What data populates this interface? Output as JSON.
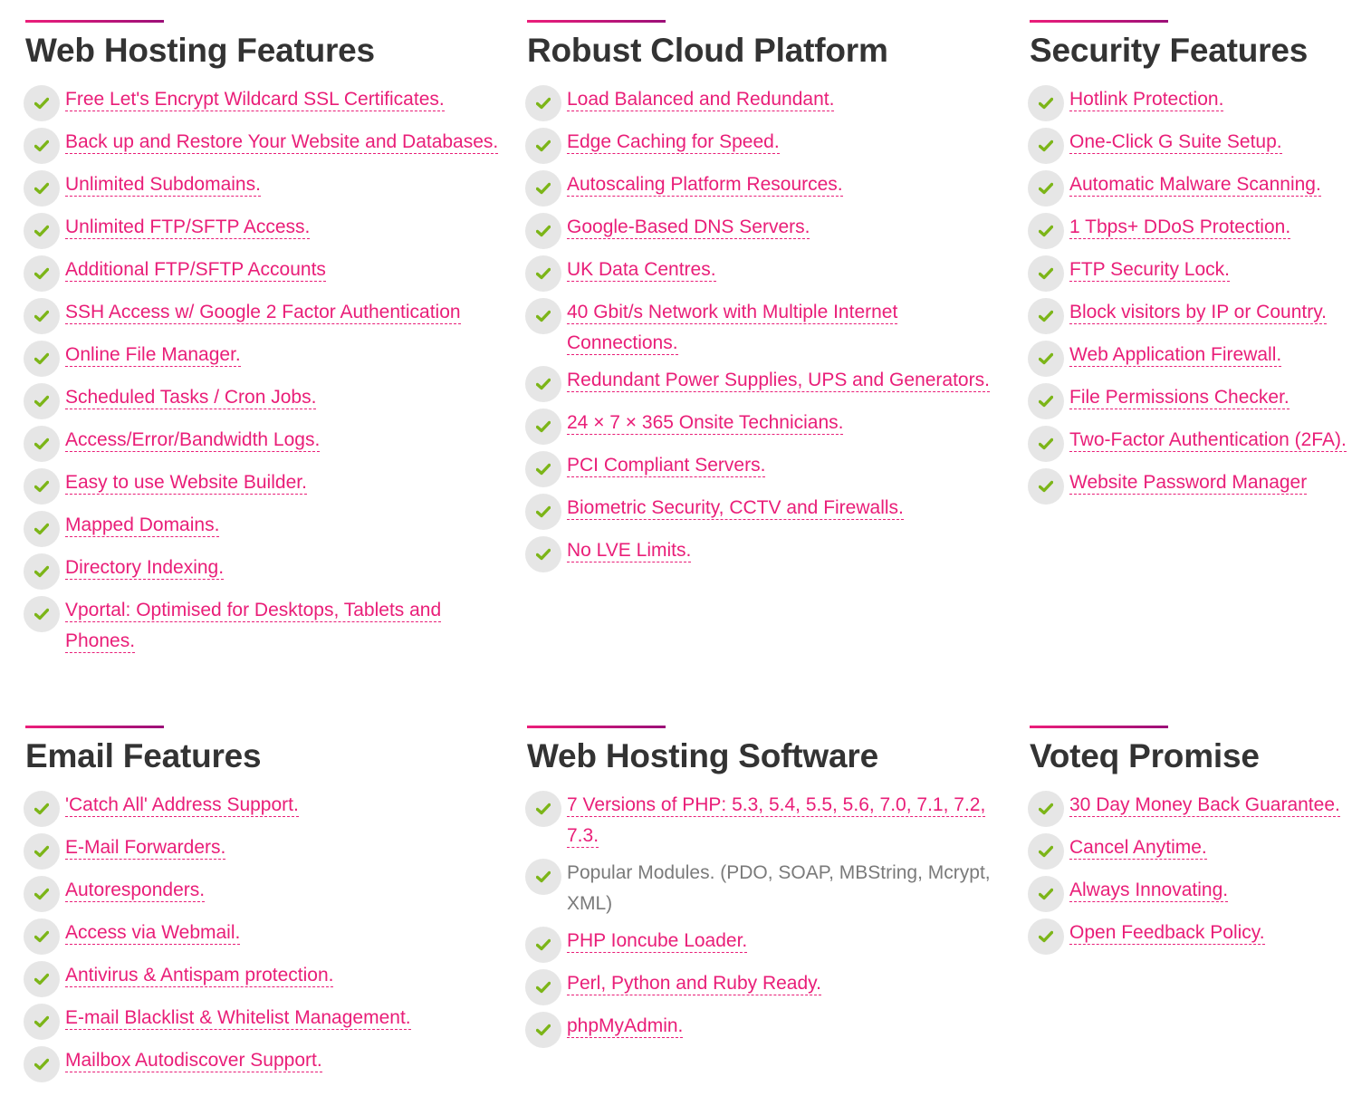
{
  "colors": {
    "accent_start": "#ec1e7a",
    "accent_end": "#9b0f78",
    "link": "#e91e78",
    "heading": "#333333",
    "check": "#7cb518",
    "check_bg": "#e6e6e6",
    "plain_text": "#7a7a7a"
  },
  "sections": [
    {
      "title": "Web Hosting Features",
      "items": [
        {
          "label": "Free Let's Encrypt Wildcard SSL Certificates.",
          "link": true
        },
        {
          "label": "Back up and Restore Your Website and Databases.",
          "link": true
        },
        {
          "label": "Unlimited Subdomains.",
          "link": true
        },
        {
          "label": "Unlimited FTP/SFTP Access.",
          "link": true
        },
        {
          "label": "Additional FTP/SFTP Accounts",
          "link": true
        },
        {
          "label": "SSH Access w/ Google 2 Factor Authentication",
          "link": true
        },
        {
          "label": "Online File Manager.",
          "link": true
        },
        {
          "label": "Scheduled Tasks / Cron Jobs.",
          "link": true
        },
        {
          "label": "Access/Error/Bandwidth Logs.",
          "link": true
        },
        {
          "label": "Easy to use Website Builder.",
          "link": true
        },
        {
          "label": "Mapped Domains.",
          "link": true
        },
        {
          "label": "Directory Indexing.",
          "link": true
        },
        {
          "label": "Vportal: Optimised for Desktops, Tablets and Phones.",
          "link": true
        }
      ]
    },
    {
      "title": "Robust Cloud Platform",
      "items": [
        {
          "label": "Load Balanced and Redundant.",
          "link": true
        },
        {
          "label": "Edge Caching for Speed.",
          "link": true
        },
        {
          "label": "Autoscaling Platform Resources.",
          "link": true
        },
        {
          "label": "Google-Based DNS Servers.",
          "link": true
        },
        {
          "label": "UK Data Centres.",
          "link": true
        },
        {
          "label": "40 Gbit/s Network with Multiple Internet Connections.",
          "link": true
        },
        {
          "label": "Redundant Power Supplies, UPS and Generators.",
          "link": true
        },
        {
          "label": "24 × 7 × 365 Onsite Technicians.",
          "link": true
        },
        {
          "label": "PCI Compliant Servers.",
          "link": true
        },
        {
          "label": "Biometric Security, CCTV and Firewalls.",
          "link": true
        },
        {
          "label": "No LVE Limits.",
          "link": true
        }
      ]
    },
    {
      "title": "Security Features",
      "items": [
        {
          "label": "Hotlink Protection.",
          "link": true
        },
        {
          "label": "One-Click G Suite Setup.",
          "link": true
        },
        {
          "label": "Automatic Malware Scanning.",
          "link": true
        },
        {
          "label": "1 Tbps+ DDoS Protection.",
          "link": true
        },
        {
          "label": "FTP Security Lock.",
          "link": true
        },
        {
          "label": "Block visitors by IP or Country.",
          "link": true
        },
        {
          "label": "Web Application Firewall.",
          "link": true
        },
        {
          "label": "File Permissions Checker.",
          "link": true
        },
        {
          "label": "Two-Factor Authentication (2FA).",
          "link": true
        },
        {
          "label": "Website Password Manager",
          "link": true
        }
      ]
    },
    {
      "title": "Email Features",
      "items": [
        {
          "label": "'Catch All' Address Support.",
          "link": true
        },
        {
          "label": "E-Mail Forwarders.",
          "link": true
        },
        {
          "label": "Autoresponders.",
          "link": true
        },
        {
          "label": "Access via Webmail.",
          "link": true
        },
        {
          "label": "Antivirus & Antispam protection.",
          "link": true
        },
        {
          "label": "E-mail Blacklist & Whitelist Management.",
          "link": true
        },
        {
          "label": "Mailbox Autodiscover Support.",
          "link": true
        }
      ]
    },
    {
      "title": "Web Hosting Software",
      "items": [
        {
          "label": "7 Versions of PHP: 5.3, 5.4, 5.5, 5.6, 7.0, 7.1, 7.2, 7.3.",
          "link": true
        },
        {
          "label": "Popular Modules. (PDO, SOAP, MBString, Mcrypt, XML)",
          "link": false
        },
        {
          "label": "PHP Ioncube Loader.",
          "link": true
        },
        {
          "label": "Perl, Python and Ruby Ready.",
          "link": true
        },
        {
          "label": "phpMyAdmin.",
          "link": true
        }
      ]
    },
    {
      "title": "Voteq Promise",
      "items": [
        {
          "label": "30 Day Money Back Guarantee.",
          "link": true
        },
        {
          "label": "Cancel Anytime.",
          "link": true
        },
        {
          "label": "Always Innovating.",
          "link": true
        },
        {
          "label": "Open Feedback Policy.",
          "link": true
        }
      ]
    }
  ]
}
